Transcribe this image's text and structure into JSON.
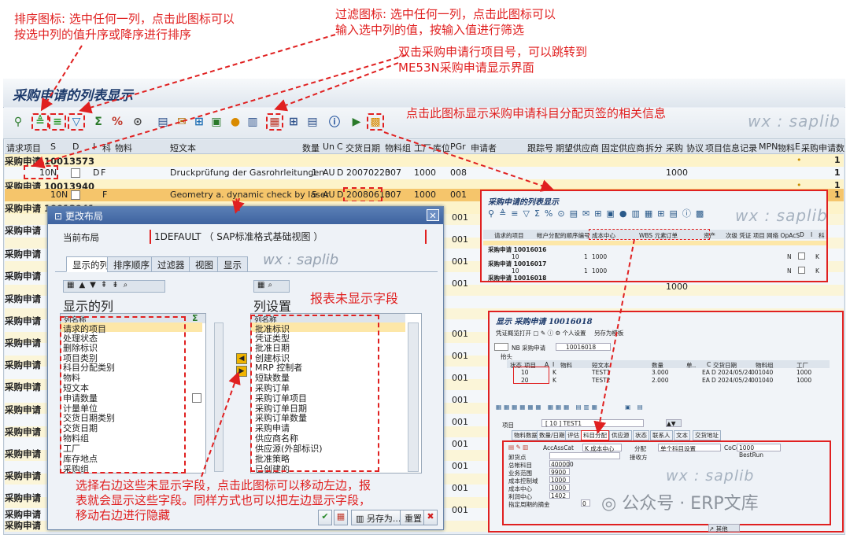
{
  "annotations": {
    "sort": [
      "排序图标: 选中任何一列，点击此图标可以",
      "按选中列的值升序或降序进行排序"
    ],
    "filter": [
      "过滤图标: 选中任何一列，点击此图标可以",
      "输入选中列的值，按输入值进行筛选"
    ],
    "jump": [
      "双击采购申请行项目号，可以跳转到",
      "ME53N采购申请显示界面"
    ],
    "account": "点击此图标显示采购申请科目分配页签的相关信息",
    "unshown": "报表未显示字段",
    "move": [
      "选择右边这些未显示字段，点击此图标可以移动左边，报",
      "表就会显示这些字段。同样方式也可以把左边显示字段，",
      "移动右边进行隐藏"
    ]
  },
  "window": {
    "title": "采购申请的列表显示",
    "watermark": "wx : saplib"
  },
  "table": {
    "headers": [
      "请求项目",
      "S",
      "D",
      "I",
      "科",
      "物料",
      "短文本",
      "数量",
      "Un",
      "C",
      "交货日期",
      "物料组",
      "工厂",
      "库位",
      "PGr",
      "申请者",
      "跟踪号",
      "期望供应商",
      "固定供应商",
      "拆分",
      "采购",
      "协议",
      "项目",
      "信息记录",
      "MPN",
      "物料",
      "E",
      "采购申请数"
    ],
    "groups": [
      "采购申请 10013573",
      "采购申请 10013940",
      "采购申请 10013941",
      "采购申请",
      "采购申请",
      "采购申请",
      "采购申请",
      "采购申请",
      "采购申请",
      "采购申请",
      "采购申请",
      "采购申请",
      "采购申请",
      "采购申请",
      "采购申请",
      "采购申请",
      "采购申请",
      "采购申请"
    ],
    "rows": [
      {
        "item": "10",
        "s": "N",
        "i": "D",
        "k": "F",
        "text": "Druckprüfung der Gasrohrleitungen",
        "qty": "1",
        "un": "AU",
        "c": "D",
        "date": "20070223",
        "mg": "007",
        "plant": "1000",
        "pgr": "008",
        "purch": "1000",
        "count": "1"
      },
      {
        "item": "10",
        "s": "N",
        "i": "",
        "k": "F",
        "text": "Geometry a. dynamic check by laser",
        "qty": "5",
        "un": "AU",
        "c": "D",
        "date": "20080613",
        "mg": "007",
        "plant": "1000",
        "pgr": "001",
        "purch": "",
        "count": "1"
      }
    ],
    "right_count": "1",
    "extra_col": [
      "001",
      "001",
      "001",
      "001",
      "001",
      "001",
      "001",
      "001",
      "001",
      "001",
      "001",
      "001",
      "001",
      "001",
      "001"
    ],
    "extra_purch": [
      "1000",
      "1000",
      "1000"
    ],
    "dots": "•"
  },
  "dialog": {
    "title": "更改布局",
    "layout_label": "当前布局",
    "layout_value": "1DEFAULT （ SAP标准格式基础视图 ）",
    "tabs": [
      "显示的列",
      "排序顺序",
      "过滤器",
      "视图",
      "显示"
    ],
    "watermark": "wx : saplib",
    "left_title": "显示的列",
    "left_header": "列名称",
    "left_items": [
      "请求的项目",
      "处理状态",
      "删除标识",
      "项目类别",
      "科目分配类别",
      "物料",
      "短文本",
      "申请数量",
      "计量单位",
      "交货日期类别",
      "交货日期",
      "物料组",
      "工厂",
      "库存地点",
      "采购组"
    ],
    "right_title": "列设置",
    "right_header": "列名称",
    "right_items": [
      "批准标识",
      "凭证类型",
      "批准日期",
      "创建标识",
      "MRP 控制者",
      "短缺数量",
      "采购订单",
      "采购订单项目",
      "采购订单日期",
      "采购订单数量",
      "采购申请",
      "供应商名称",
      "供应源(外部标识)",
      "批准策略",
      "已创建的"
    ],
    "buttons": [
      "另存为...",
      "重置"
    ]
  },
  "thumb1": {
    "title": "采购申请的列表显示",
    "watermark": "wx : saplib",
    "headers": [
      "请求的项目",
      "帐户分配的顺序编号",
      "成本中心",
      "WBS 元素",
      "订单",
      "资产",
      "次级 凭证 项目 网络 OpAcS",
      "D",
      "I",
      "科"
    ],
    "rows": [
      {
        "group": "采购申请 10016016",
        "item": "10",
        "seq": "1",
        "cc": "1000",
        "d": "N",
        "k": "K"
      },
      {
        "group": "采购申请 10016017",
        "item": "10",
        "seq": "1",
        "cc": "1000",
        "d": "N",
        "k": "K"
      },
      {
        "group": "采购申请 10016018"
      }
    ]
  },
  "thumb2": {
    "title": "显示 采购申请 10016018",
    "toolbar": [
      "凭证概览打开",
      "个人设置",
      "另存为模板"
    ],
    "doc_label": "NB 采购申请",
    "doc_value": "10016018",
    "sub": "抬头",
    "headers": [
      "状态",
      "项目",
      "A",
      "I",
      "物料",
      "短文本",
      "数量",
      "单..",
      "C",
      "交货日期",
      "物料组",
      "工厂"
    ],
    "items": [
      {
        "item": "10",
        "k": "K",
        "text": "TEST1",
        "qty": "3.000",
        "un": "EA",
        "c": "D",
        "date": "2024/05/24",
        "mg": "001",
        "mg2": "040",
        "plant": "1000"
      },
      {
        "item": "20",
        "k": "K",
        "text": "TEST2",
        "qty": "2.000",
        "un": "EA",
        "c": "D",
        "date": "2024/05/24",
        "mg": "001",
        "mg2": "040",
        "plant": "1000"
      }
    ],
    "item_label": "项目",
    "item_value": "[ 10 ] TEST1",
    "tabs": [
      "物料数据",
      "数量/日期",
      "评估",
      "科目分配",
      "供应源",
      "状态",
      "联系人",
      "文本",
      "交货地址"
    ],
    "acct": {
      "label1": "AccAssCat",
      "v1": "K 成本中心",
      "label2": "分配",
      "v2": "单个科目设置",
      "label3": "CoCd",
      "v3": "1000 BestRun"
    },
    "fields": [
      "卸货点",
      "总帐科目",
      "业务范围",
      "成本控制域",
      "成本中心",
      "利润中心",
      "指定周期的摘金"
    ],
    "values": [
      "",
      "400000",
      "9900",
      "1000",
      "1000",
      "1402",
      "0"
    ],
    "receiver": "接收方",
    "watermark": "wx : saplib"
  },
  "footer_logo": "公众号 · ERP文库"
}
